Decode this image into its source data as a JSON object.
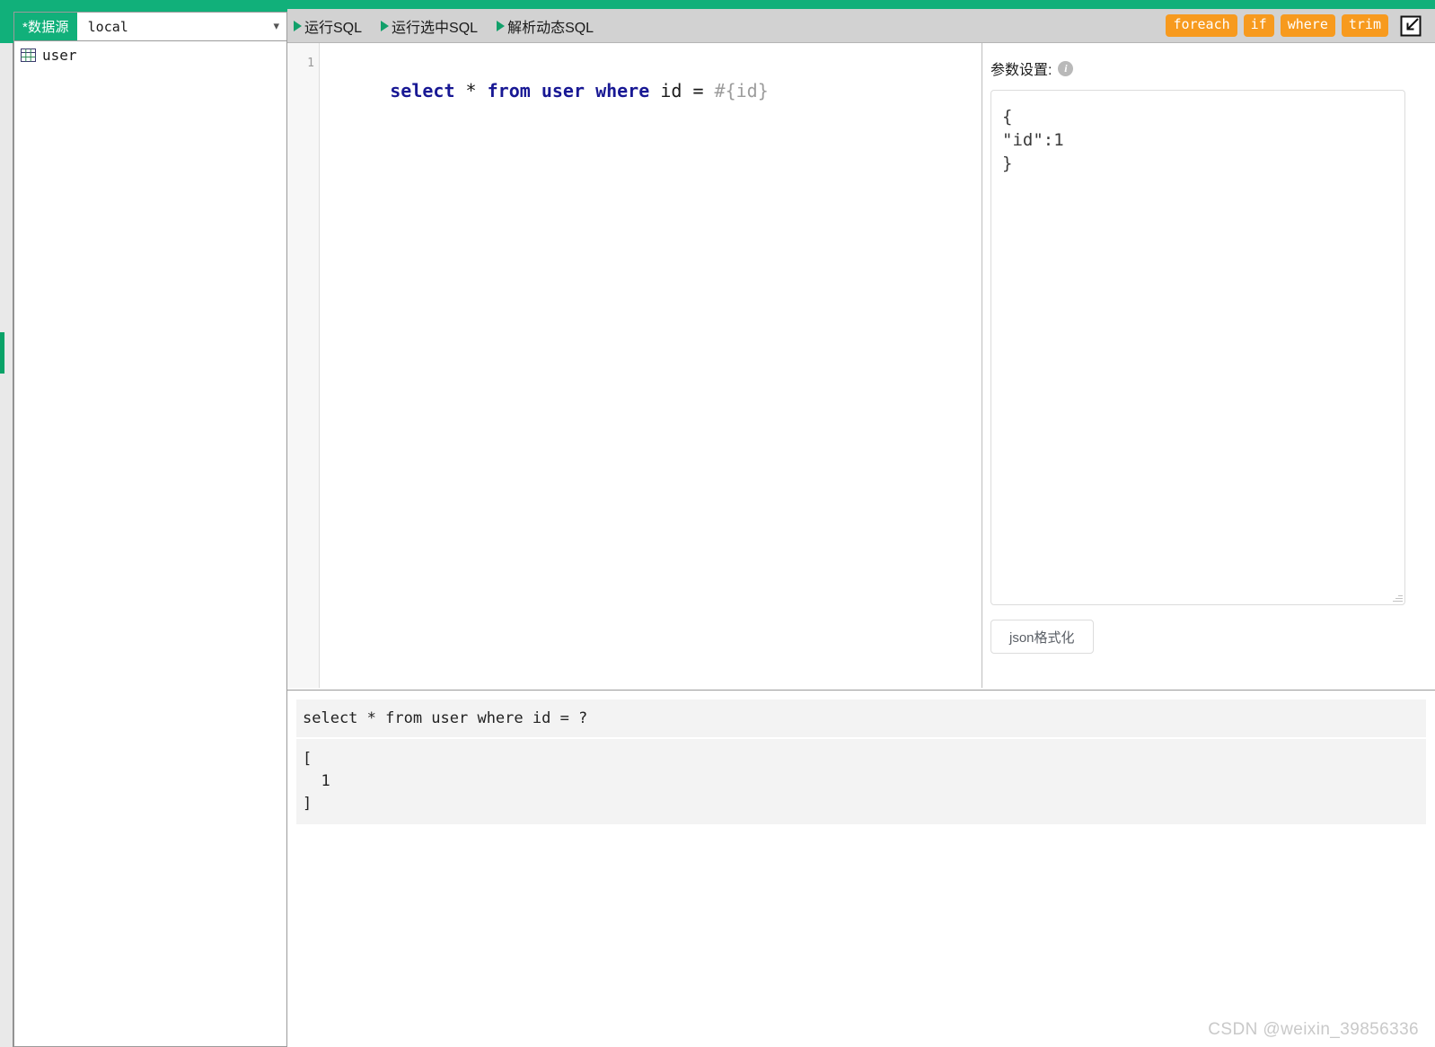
{
  "datasource": {
    "label": "*数据源",
    "selected": "local",
    "chevron_icon": "chevron-down-icon"
  },
  "sidebar": {
    "items": [
      {
        "label": "user",
        "icon": "table-icon"
      }
    ]
  },
  "toolbar": {
    "buttons": [
      {
        "label": "运行SQL",
        "icon": "play-triangle-icon"
      },
      {
        "label": "运行选中SQL",
        "icon": "play-triangle-icon"
      },
      {
        "label": "解析动态SQL",
        "icon": "play-triangle-icon"
      }
    ],
    "tags": [
      "foreach",
      "if",
      "where",
      "trim"
    ],
    "expand_icon": "collapse-restore-icon",
    "accent_color": "#f79a1e",
    "play_color": "#11a06a",
    "background": "#d2d2d2"
  },
  "editor": {
    "line_number": "1",
    "sql_tokens": [
      {
        "text": "select",
        "type": "kw"
      },
      {
        "text": " * ",
        "type": "pl"
      },
      {
        "text": "from",
        "type": "kw"
      },
      {
        "text": " ",
        "type": "pl"
      },
      {
        "text": "user",
        "type": "kw"
      },
      {
        "text": " ",
        "type": "pl"
      },
      {
        "text": "where",
        "type": "kw"
      },
      {
        "text": " id = ",
        "type": "pl"
      },
      {
        "text": "#{id}",
        "type": "ph"
      }
    ],
    "sql_text": "select * from user where id = #{id}"
  },
  "params": {
    "title": "参数设置:",
    "info_icon": "info-icon",
    "info_glyph": "i",
    "value": "{\n\"id\":1\n}",
    "format_button": "json格式化"
  },
  "results": {
    "sql": "select * from user where id = ?",
    "parameters": "[\n  1\n]"
  },
  "watermark": "CSDN @weixin_39856336",
  "theme": {
    "green": "#11b07a",
    "orange": "#f79a1e",
    "keyword_blue": "#181894"
  }
}
